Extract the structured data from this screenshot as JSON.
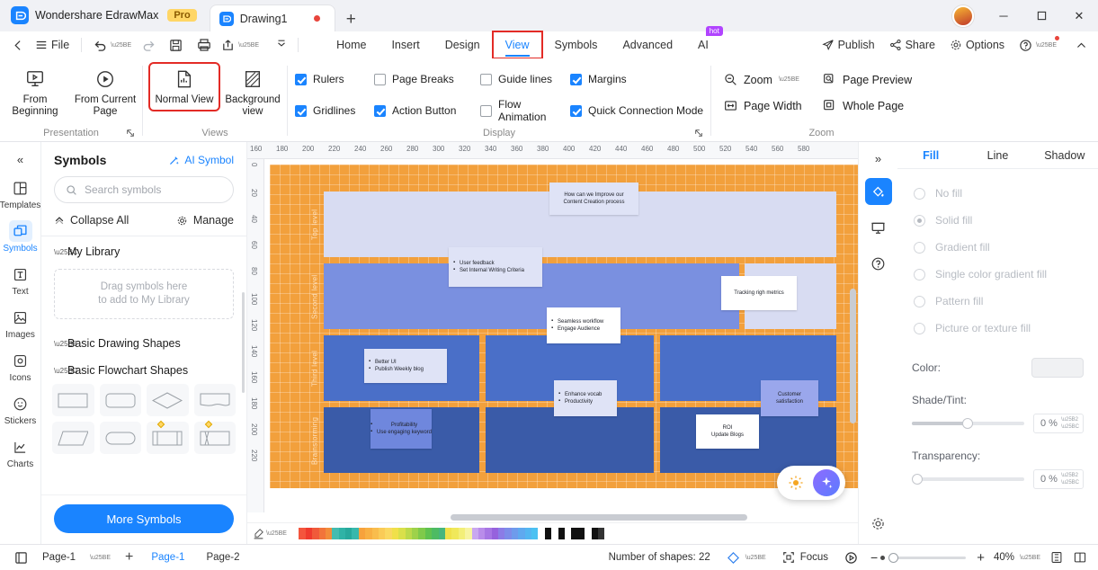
{
  "titlebar": {
    "brand": "Wondershare EdrawMax",
    "pro_badge": "Pro",
    "document_tab": "Drawing1",
    "new_tab_label": "+",
    "minimize": "─",
    "maximize": "☐",
    "close": "✕"
  },
  "menubar": {
    "back": "‹",
    "file": "File",
    "undo": "undo",
    "redo": "redo",
    "save": "save",
    "print": "print",
    "export": "export",
    "more": "more",
    "tabs": [
      {
        "label": "Home",
        "active": false
      },
      {
        "label": "Insert",
        "active": false
      },
      {
        "label": "Design",
        "active": false
      },
      {
        "label": "View",
        "active": true
      },
      {
        "label": "Symbols",
        "active": false
      },
      {
        "label": "Advanced",
        "active": false
      },
      {
        "label": "AI",
        "active": false,
        "badge": "hot"
      }
    ],
    "right": {
      "publish": "Publish",
      "share": "Share",
      "options": "Options",
      "help": "?",
      "collapse": "⌃"
    }
  },
  "ribbon": {
    "presentation": {
      "title": "Presentation",
      "buttons": [
        {
          "label": "From Beginning",
          "icon": "present-screen-icon"
        },
        {
          "label": "From Current Page",
          "icon": "play-circle-icon"
        }
      ]
    },
    "views": {
      "title": "Views",
      "buttons": [
        {
          "label": "Normal View",
          "icon": "normal-view-icon",
          "selected": true
        },
        {
          "label": "Background view",
          "icon": "background-view-icon",
          "selected": false
        }
      ]
    },
    "display": {
      "title": "Display",
      "checkboxes": [
        {
          "label": "Rulers",
          "checked": true
        },
        {
          "label": "Page Breaks",
          "checked": false
        },
        {
          "label": "Guide lines",
          "checked": false
        },
        {
          "label": "Margins",
          "checked": true
        },
        {
          "label": "Gridlines",
          "checked": true
        },
        {
          "label": "Action Button",
          "checked": true
        },
        {
          "label": "Flow Animation",
          "checked": false
        },
        {
          "label": "Quick Connection Mode",
          "checked": true
        }
      ]
    },
    "zoom": {
      "title": "Zoom",
      "items": [
        {
          "label": "Zoom",
          "icon": "zoom-out-icon",
          "has_caret": true
        },
        {
          "label": "Page Preview",
          "icon": "page-preview-icon"
        },
        {
          "label": "Page Width",
          "icon": "page-width-icon"
        },
        {
          "label": "Whole Page",
          "icon": "whole-page-icon"
        }
      ]
    }
  },
  "left_rail": {
    "collapse": "«",
    "items": [
      {
        "label": "Templates",
        "icon": "templates-icon",
        "active": false
      },
      {
        "label": "Symbols",
        "icon": "symbols-icon",
        "active": true
      },
      {
        "label": "Text",
        "icon": "text-icon",
        "active": false
      },
      {
        "label": "Images",
        "icon": "images-icon",
        "active": false
      },
      {
        "label": "Icons",
        "icon": "icons-icon",
        "active": false
      },
      {
        "label": "Stickers",
        "icon": "stickers-icon",
        "active": false
      },
      {
        "label": "Charts",
        "icon": "charts-icon",
        "active": false
      }
    ]
  },
  "symbols_panel": {
    "title": "Symbols",
    "ai_symbol": "AI Symbol",
    "search_placeholder": "Search symbols",
    "collapse_all": "Collapse All",
    "manage": "Manage",
    "sections": [
      {
        "label": "My Library",
        "expanded": true
      },
      {
        "label": "Basic Drawing Shapes",
        "expanded": false
      },
      {
        "label": "Basic Flowchart Shapes",
        "expanded": true
      }
    ],
    "drop_hint_line1": "Drag symbols here",
    "drop_hint_line2": "to add to My Library",
    "more_symbols": "More Symbols"
  },
  "canvas": {
    "h_ruler_ticks": [
      "160",
      "180",
      "200",
      "220",
      "240",
      "260",
      "280",
      "300",
      "320",
      "340",
      "360",
      "380",
      "400",
      "420",
      "440",
      "460",
      "480",
      "500",
      "520",
      "540",
      "560",
      "580"
    ],
    "v_ruler_ticks": [
      "0",
      "20",
      "40",
      "60",
      "80",
      "100",
      "120",
      "140",
      "160",
      "180",
      "200",
      "220"
    ],
    "band_labels": [
      "Top level",
      "Second level",
      "Third level",
      "Brainstorming"
    ],
    "notes": [
      {
        "title": "How can we Improve our Content Creation process",
        "lines": [
          "How can we Improve our",
          "Content Creation process"
        ],
        "style": "plain"
      },
      {
        "lines": [
          "User feedback",
          "Set Internal Writing Criteria"
        ],
        "style": "bullets"
      },
      {
        "lines": [
          "Tracking righ metrics"
        ],
        "style": "plain"
      },
      {
        "lines": [
          "Seamless workflow",
          "Engage Audience"
        ],
        "style": "bullets"
      },
      {
        "lines": [
          "Better UI",
          "Publish Weekly blog"
        ],
        "style": "bullets"
      },
      {
        "lines": [
          "Enhance vocab",
          "Productivity"
        ],
        "style": "bullets"
      },
      {
        "lines": [
          "Customer satisfaction"
        ],
        "style": "plain"
      },
      {
        "lines": [
          "Profitability",
          "Use engaging keyword"
        ],
        "style": "bullets"
      },
      {
        "lines": [
          "ROI",
          "Update Blogs"
        ],
        "style": "plain"
      }
    ],
    "fab": {
      "light": "light-bulb-icon",
      "ai": "ai-sparkle-icon"
    }
  },
  "right_rail": {
    "expand": "»",
    "items": [
      {
        "icon": "fill-bucket-icon",
        "active": true
      },
      {
        "icon": "presentation-icon",
        "active": false
      },
      {
        "icon": "help-circle-icon",
        "active": false
      }
    ],
    "gear": "gear-icon"
  },
  "fill_panel": {
    "tabs": [
      {
        "label": "Fill",
        "active": true
      },
      {
        "label": "Line",
        "active": false
      },
      {
        "label": "Shadow",
        "active": false
      }
    ],
    "options": [
      {
        "label": "No fill",
        "selected": false
      },
      {
        "label": "Solid fill",
        "selected": true
      },
      {
        "label": "Gradient fill",
        "selected": false
      },
      {
        "label": "Single color gradient fill",
        "selected": false
      },
      {
        "label": "Pattern fill",
        "selected": false
      },
      {
        "label": "Picture or texture fill",
        "selected": false
      }
    ],
    "color_label": "Color:",
    "shade_label": "Shade/Tint:",
    "shade_value": "0 %",
    "transparency_label": "Transparency:",
    "transparency_value": "0 %"
  },
  "status_bar": {
    "page_selector_icon": "page-icon",
    "current_page": "Page-1",
    "add_page": "+",
    "page_tabs": [
      {
        "label": "Page-1",
        "active": true
      },
      {
        "label": "Page-2",
        "active": false
      }
    ],
    "shape_count": "Number of shapes: 22",
    "theme_icon": "theme-icon",
    "focus": "Focus",
    "presentation_icon": "present-icon",
    "zoom_out": "−",
    "zoom_in": "+",
    "zoom_level": "40%",
    "fit_page_icon": "fit-page-icon",
    "fit_width_icon": "fit-width-icon"
  },
  "colors": {
    "accent": "#1a84ff",
    "highlight_box": "#e32b26",
    "page_bg": "#f2a03c",
    "band_light": "#d8dcf2",
    "band_mid": "#7a90e0",
    "band_dark": "#4a6fc8",
    "band_darker": "#3a5ba8",
    "note_light": "#dfe3f6",
    "note_white": "#ffffff",
    "note_violet": "#9aa7ec"
  },
  "palette_swatches": [
    "#ffffff",
    "#e8453c",
    "#f2674a",
    "#f2994a",
    "#f2c94c",
    "#6fcf97",
    "#27ae60",
    "#56ccf2",
    "#2d9cdb",
    "#2f80ed",
    "#9b51e0",
    "#bb6bd9",
    "#eb5757",
    "#f2994a",
    "#f2c94c",
    "#219653",
    "#27ae60",
    "#2f80ed",
    "#56ccf2",
    "#9b51e0",
    "#333333",
    "#4f4f4f",
    "#828282",
    "#bdbdbd",
    "#e0e0e0",
    "#000000"
  ]
}
